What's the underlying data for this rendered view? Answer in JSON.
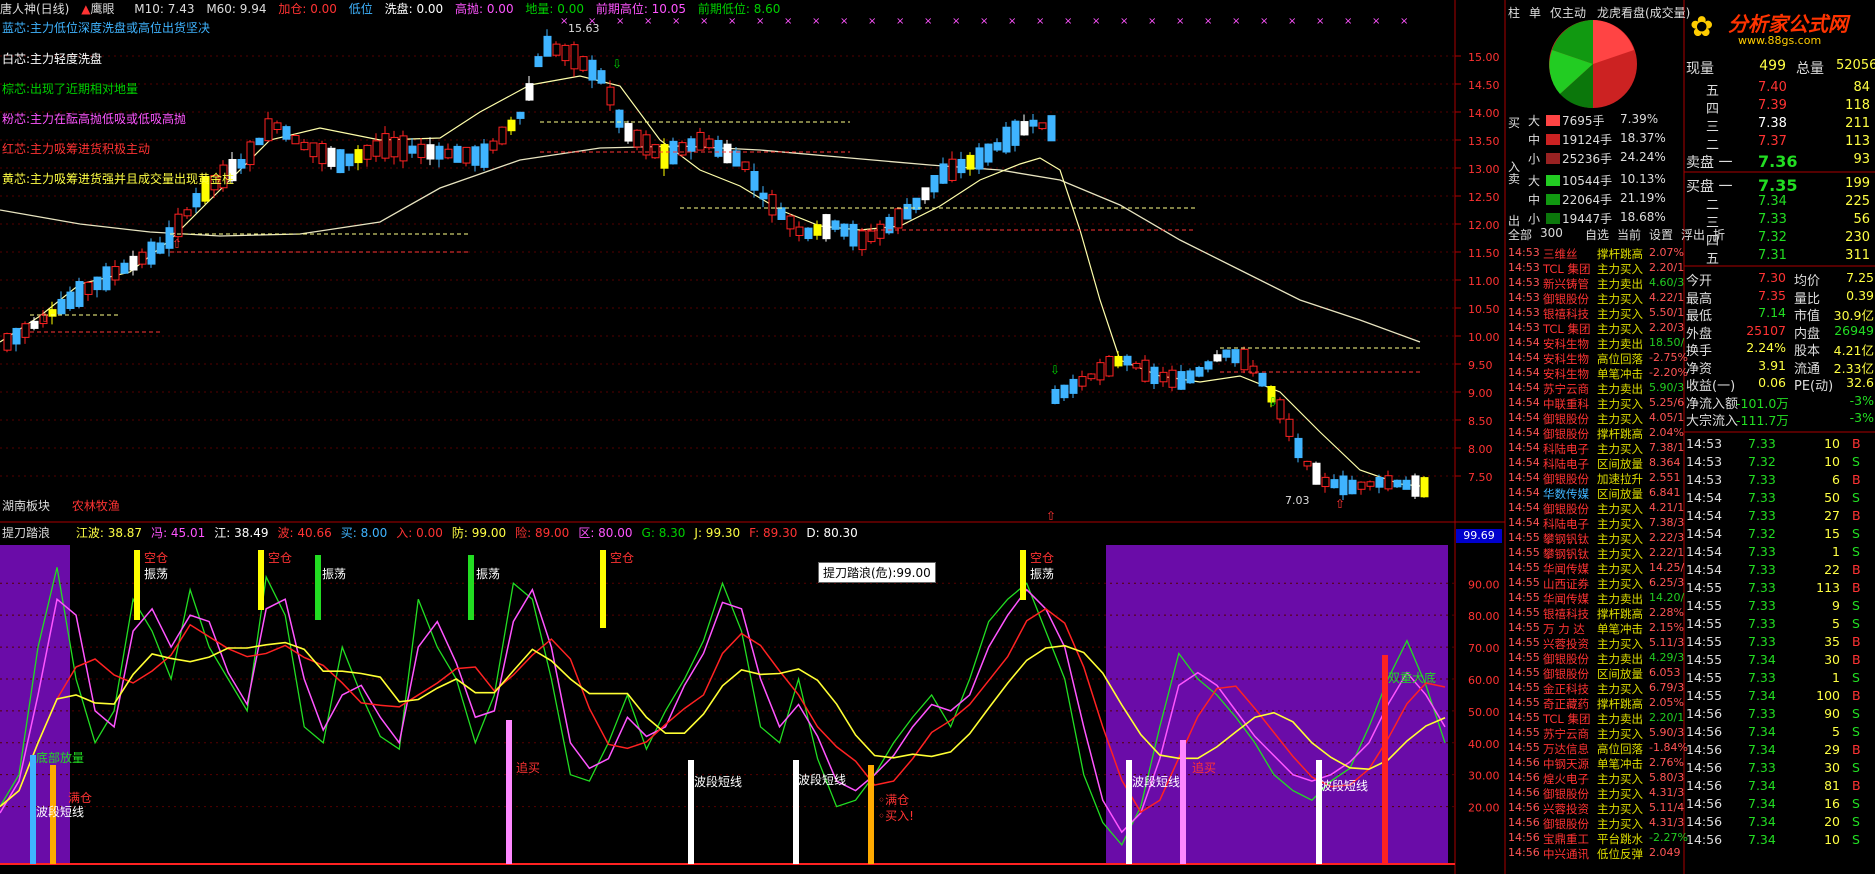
{
  "header": {
    "title": "唐人神(日线)",
    "mode": "鹰眼",
    "ma10": "M10: 7.43",
    "ma60": "M60: 9.94",
    "add": "加仓: 0.00",
    "low": "低位",
    "wash": "洗盘: 0.00",
    "high_sell": "高抛: 0.00",
    "ground": "地量: 0.00",
    "prev_high": "前期高位: 10.05",
    "prev_low": "前期低位: 8.60"
  },
  "legend": [
    {
      "text": "蓝芯:主力低位深度洗盘或高位出货坚决",
      "color": "#3fb4ff"
    },
    {
      "text": "白芯:主力轻度洗盘",
      "color": "#ffffff"
    },
    {
      "text": "棕芯:出现了近期相对地量",
      "color": "#00d000"
    },
    {
      "text": "粉芯:主力在酝高抛低吸或低吸高抛",
      "color": "#ff55ff"
    },
    {
      "text": "红芯:主力吸筹进货积极主动",
      "color": "#ff3333"
    },
    {
      "text": "黄芯:主力吸筹进货强并且成交量出现黄金柱",
      "color": "#ffff44"
    }
  ],
  "sectors": {
    "a": "湖南板块",
    "b": "农林牧渔"
  },
  "price_axis": [
    "15.00",
    "14.50",
    "14.00",
    "13.50",
    "13.00",
    "12.50",
    "12.00",
    "11.50",
    "11.00",
    "10.50",
    "10.00",
    "9.50",
    "9.00",
    "8.50",
    "8.00",
    "7.50"
  ],
  "annotations": {
    "high_label": "15.63",
    "low_label": "7.03"
  },
  "indicator": {
    "name": "提刀踏浪",
    "values": [
      {
        "text": "江波: 38.87",
        "color": "#ffff44"
      },
      {
        "text": "冯: 45.01",
        "color": "#ff55ff"
      },
      {
        "text": "江: 38.49",
        "color": "#ffffff"
      },
      {
        "text": "波: 40.66",
        "color": "#ff3333"
      },
      {
        "text": "买: 8.00",
        "color": "#3fb4ff"
      },
      {
        "text": "入: 0.00",
        "color": "#ff3333"
      },
      {
        "text": "防: 99.00",
        "color": "#ffff44"
      },
      {
        "text": "险: 89.00",
        "color": "#ff3333"
      },
      {
        "text": "区: 80.00",
        "color": "#ff55ff"
      },
      {
        "text": "G: 8.30",
        "color": "#00d000"
      },
      {
        "text": "J: 99.30",
        "color": "#ffff44"
      },
      {
        "text": "F: 89.30",
        "color": "#ff3333"
      },
      {
        "text": "D: 80.30",
        "color": "#ffffff"
      }
    ],
    "tooltip": "提刀踏浪(危):99.00",
    "axis_badge": "99.69",
    "axis": [
      "90.00",
      "80.00",
      "70.00",
      "60.00",
      "50.00",
      "40.00",
      "30.00",
      "20.00"
    ],
    "signals": {
      "empty": "空仓",
      "shake": "振荡",
      "bottom": "底部放量",
      "full": "满仓",
      "band": "波段短线",
      "chase": "追买",
      "full_buy": "满仓 买入!",
      "dbl_bottom": "双重大底"
    }
  },
  "right": {
    "tabs": [
      "柱",
      "单",
      "仅主动",
      "龙虎看盘(成交量)"
    ],
    "logo_main": "分析家公式网",
    "logo_sub": "www.88gs.com",
    "volume": {
      "label": "现量",
      "value": "499",
      "total_label": "总量",
      "total": "52056"
    },
    "asks": [
      {
        "lvl": "五",
        "price": "7.40",
        "vol": "84"
      },
      {
        "lvl": "四",
        "price": "7.39",
        "vol": "118"
      },
      {
        "lvl": "三",
        "price": "7.38",
        "vol": "211"
      },
      {
        "lvl": "二",
        "price": "7.37",
        "vol": "113"
      },
      {
        "lvl": "卖盘 一",
        "price": "7.36",
        "vol": "93"
      }
    ],
    "bids": [
      {
        "lvl": "买盘 一",
        "price": "7.35",
        "vol": "199"
      },
      {
        "lvl": "二",
        "price": "7.34",
        "vol": "225"
      },
      {
        "lvl": "三",
        "price": "7.33",
        "vol": "56"
      },
      {
        "lvl": "四",
        "price": "7.32",
        "vol": "230"
      },
      {
        "lvl": "五",
        "price": "7.31",
        "vol": "311"
      }
    ],
    "stats": [
      [
        "今开",
        "7.30",
        "均价",
        "7.25"
      ],
      [
        "最高",
        "7.35",
        "量比",
        "0.39"
      ],
      [
        "最低",
        "7.14",
        "市值",
        "30.9亿"
      ],
      [
        "外盘",
        "25107",
        "内盘",
        "26949"
      ],
      [
        "换手",
        "2.24%",
        "股本",
        "4.21亿"
      ],
      [
        "净资",
        "3.91",
        "流通",
        "2.33亿"
      ],
      [
        "收益(一)",
        "0.06",
        "PE(动)",
        "32.6"
      ],
      [
        "净流入额",
        "-101.0万",
        "",
        "-3%"
      ],
      [
        "大宗流入",
        "-111.7万",
        "",
        "-3%"
      ]
    ],
    "ticks": [
      [
        "14:53",
        "7.33",
        "10",
        "B"
      ],
      [
        "14:53",
        "7.32",
        "10",
        "S"
      ],
      [
        "14:53",
        "7.33",
        "6",
        "B"
      ],
      [
        "14:54",
        "7.33",
        "50",
        "S"
      ],
      [
        "14:54",
        "7.33",
        "27",
        "B"
      ],
      [
        "14:54",
        "7.32",
        "15",
        "S"
      ],
      [
        "14:54",
        "7.33",
        "1",
        "S"
      ],
      [
        "14:54",
        "7.33",
        "22",
        "B"
      ],
      [
        "14:55",
        "7.33",
        "113",
        "B"
      ],
      [
        "14:55",
        "7.33",
        "9",
        "S"
      ],
      [
        "14:55",
        "7.33",
        "5",
        "S"
      ],
      [
        "14:55",
        "7.33",
        "35",
        "B"
      ],
      [
        "14:55",
        "7.34",
        "30",
        "B"
      ],
      [
        "14:55",
        "7.33",
        "1",
        "S"
      ],
      [
        "14:55",
        "7.34",
        "100",
        "B"
      ],
      [
        "14:56",
        "7.33",
        "90",
        "S"
      ],
      [
        "14:56",
        "7.34",
        "5",
        "S"
      ],
      [
        "14:56",
        "7.34",
        "29",
        "B"
      ],
      [
        "14:56",
        "7.33",
        "30",
        "S"
      ],
      [
        "14:56",
        "7.34",
        "81",
        "B"
      ],
      [
        "14:56",
        "7.34",
        "16",
        "S"
      ],
      [
        "14:56",
        "7.34",
        "20",
        "S"
      ],
      [
        "14:56",
        "7.34",
        "10",
        "S"
      ]
    ],
    "flow": {
      "buy_label": "买入",
      "sell_label": "卖出",
      "rows": [
        {
          "side": "大",
          "val": "7695手",
          "pct": "7.39%",
          "color": "#ff4444"
        },
        {
          "side": "中",
          "val": "19124手",
          "pct": "18.37%",
          "color": "#cc2222"
        },
        {
          "side": "小",
          "val": "25236手",
          "pct": "24.24%",
          "color": "#992222"
        },
        {
          "side": "大",
          "val": "10544手",
          "pct": "10.13%",
          "color": "#22cc22"
        },
        {
          "side": "中",
          "val": "22064手",
          "pct": "21.19%",
          "color": "#119911"
        },
        {
          "side": "小",
          "val": "19447手",
          "pct": "18.68%",
          "color": "#0b770b"
        }
      ]
    },
    "tape_tabs": [
      "全部",
      "300",
      "自选",
      "当前",
      "设置",
      "浮出",
      "折"
    ],
    "tape": [
      [
        "14:53",
        "三维丝",
        "撑杆跳高",
        "2.07%"
      ],
      [
        "14:53",
        "TCL 集团",
        "主力买入",
        "2.20/1"
      ],
      [
        "14:53",
        "新兴铸管",
        "主力卖出",
        "4.60/3"
      ],
      [
        "14:53",
        "御银股份",
        "主力买入",
        "4.22/1"
      ],
      [
        "14:53",
        "银禧科技",
        "主力买入",
        "5.50/1"
      ],
      [
        "14:53",
        "TCL 集团",
        "主力买入",
        "2.20/3"
      ],
      [
        "14:54",
        "安科生物",
        "主力卖出",
        "18.50/"
      ],
      [
        "14:54",
        "安科生物",
        "高位回落",
        "-2.75%"
      ],
      [
        "14:54",
        "安科生物",
        "单笔冲击",
        "-2.20%"
      ],
      [
        "14:54",
        "苏宁云商",
        "主力卖出",
        "5.90/3"
      ],
      [
        "14:54",
        "中联重科",
        "主力买入",
        "5.25/6"
      ],
      [
        "14:54",
        "御银股份",
        "主力买入",
        "4.05/1"
      ],
      [
        "14:54",
        "御银股份",
        "撑杆跳高",
        "2.04%"
      ],
      [
        "14:54",
        "科陆电子",
        "主力买入",
        "7.38/1"
      ],
      [
        "14:54",
        "科陆电子",
        "区间放量",
        "8.364"
      ],
      [
        "14:54",
        "御银股份",
        "加速拉升",
        "2.551"
      ],
      [
        "14:54",
        "华数传媒",
        "区间放量",
        "6.841"
      ],
      [
        "14:54",
        "御银股份",
        "主力买入",
        "4.21/1"
      ],
      [
        "14:54",
        "科陆电子",
        "主力买入",
        "7.38/3"
      ],
      [
        "14:55",
        "攀钢钒钛",
        "主力买入",
        "2.22/3"
      ],
      [
        "14:55",
        "攀钢钒钛",
        "主力买入",
        "2.22/1"
      ],
      [
        "14:55",
        "华闻传媒",
        "主力买入",
        "14.25/"
      ],
      [
        "14:55",
        "山西证券",
        "主力买入",
        "6.25/3"
      ],
      [
        "14:55",
        "华闻传媒",
        "主力卖出",
        "14.20/"
      ],
      [
        "14:55",
        "银禧科技",
        "撑杆跳高",
        "2.28%"
      ],
      [
        "14:55",
        "万 力 达",
        "单笔冲击",
        "2.15%"
      ],
      [
        "14:55",
        "兴蓉投资",
        "主力买入",
        "5.11/3"
      ],
      [
        "14:55",
        "御银股份",
        "主力卖出",
        "4.29/3"
      ],
      [
        "14:55",
        "御银股份",
        "区间放量",
        "6.053"
      ],
      [
        "14:55",
        "金正科技",
        "主力买入",
        "6.79/3"
      ],
      [
        "14:55",
        "奇正藏药",
        "撑杆跳高",
        "2.05%"
      ],
      [
        "14:55",
        "TCL 集团",
        "主力卖出",
        "2.20/1"
      ],
      [
        "14:55",
        "苏宁云商",
        "主力买入",
        "5.90/3"
      ],
      [
        "14:55",
        "万达信息",
        "高位回落",
        "-1.84%"
      ],
      [
        "14:56",
        "中钢天源",
        "单笔冲击",
        "2.76%"
      ],
      [
        "14:56",
        "煌火电子",
        "主力买入",
        "5.80/3"
      ],
      [
        "14:56",
        "御银股份",
        "主力买入",
        "4.31/3"
      ],
      [
        "14:56",
        "兴蓉投资",
        "主力买入",
        "5.11/4"
      ],
      [
        "14:56",
        "御银股份",
        "主力买入",
        "4.31/3"
      ],
      [
        "14:56",
        "宝鼎重工",
        "平台跳水",
        "-2.27%"
      ],
      [
        "14:56",
        "中兴通讯",
        "低位反弹",
        "2.049"
      ]
    ]
  }
}
